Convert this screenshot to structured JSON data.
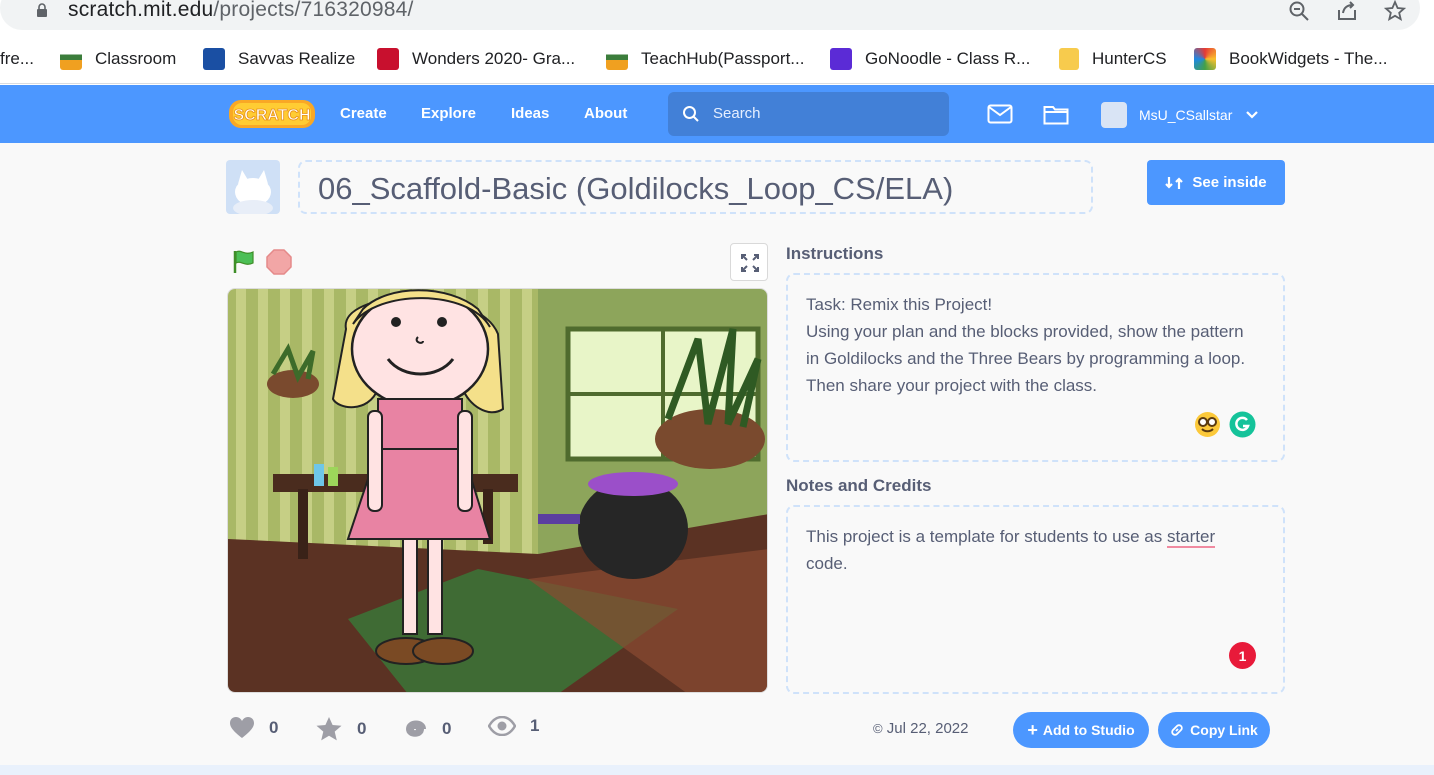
{
  "browser": {
    "url_host": "scratch.mit.edu",
    "url_path": "/projects/716320984/",
    "bookmarks": [
      {
        "label": "fre...",
        "icon": "bookmark-favicon"
      },
      {
        "label": "Classroom",
        "icon": "nyc-doe-icon"
      },
      {
        "label": "Savvas Realize",
        "icon": "savvas-icon"
      },
      {
        "label": "Wonders 2020- Gra...",
        "icon": "mcgraw-hill-icon"
      },
      {
        "label": "TeachHub(Passport...",
        "icon": "nyc-doe-icon"
      },
      {
        "label": "GoNoodle - Class R...",
        "icon": "gonoodle-icon"
      },
      {
        "label": "HunterCS",
        "icon": "folder-icon"
      },
      {
        "label": "BookWidgets - The...",
        "icon": "bookwidgets-icon"
      }
    ]
  },
  "nav": {
    "logo": "Scratch",
    "links": [
      "Create",
      "Explore",
      "Ideas",
      "About"
    ],
    "search_placeholder": "Search",
    "username": "MsU_CSallstar"
  },
  "project": {
    "title": "06_Scaffold-Basic (Goldilocks_Loop_CS/ELA)",
    "see_inside_label": "See inside",
    "instructions_heading": "Instructions",
    "instructions_text": "Task: Remix this Project!\nUsing your plan and the blocks provided, show the pattern in Goldilocks and the Three Bears by programming a loop. Then share your project with the class.",
    "notes_heading": "Notes and Credits",
    "notes_text_prefix": "This project is a template for students to use as ",
    "notes_text_underlined": "starter",
    "notes_text_suffix": "\ncode.",
    "notification_count": "1"
  },
  "stats": {
    "loves": "0",
    "favorites": "0",
    "remixes": "0",
    "views": "1"
  },
  "footer": {
    "date": "Jul 22, 2022",
    "add_to_studio_label": "Add to Studio",
    "copy_link_label": "Copy Link"
  },
  "colors": {
    "scratch_blue": "#4c97ff",
    "text": "#575e75",
    "dashed_border": "#cfe2fa"
  }
}
